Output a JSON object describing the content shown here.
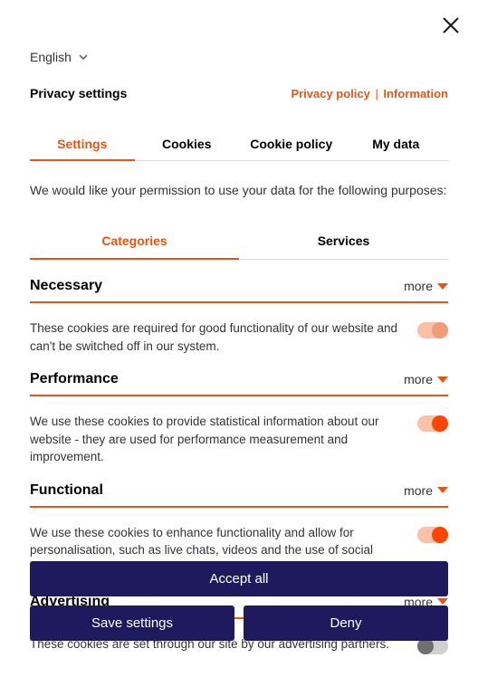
{
  "close_label": "Close",
  "language": {
    "current": "English"
  },
  "header": {
    "title": "Privacy settings",
    "privacy_policy": "Privacy policy",
    "information": "Information"
  },
  "main_tabs": {
    "settings": "Settings",
    "cookies": "Cookies",
    "cookie_policy": "Cookie policy",
    "my_data": "My data"
  },
  "intro": "We would like your permission to use your data for the following purposes:",
  "sub_tabs": {
    "categories": "Categories",
    "services": "Services"
  },
  "more_label": "more",
  "categories": {
    "necessary": {
      "title": "Necessary",
      "desc": "These cookies are required for good functionality of our website and can't be switched off in our system."
    },
    "performance": {
      "title": "Performance",
      "desc": "We use these cookies to provide statistical information about our website - they are used for performance measurement and improvement."
    },
    "functional": {
      "title": "Functional",
      "desc": "We use these cookies to enhance functionality and allow for personalisation, such as live chats, videos and the use of social media."
    },
    "advertising": {
      "title": "Advertising",
      "desc": "These cookies are set through our site by our advertising partners."
    }
  },
  "buttons": {
    "accept_all": "Accept all",
    "save_settings": "Save settings",
    "deny": "Deny"
  }
}
